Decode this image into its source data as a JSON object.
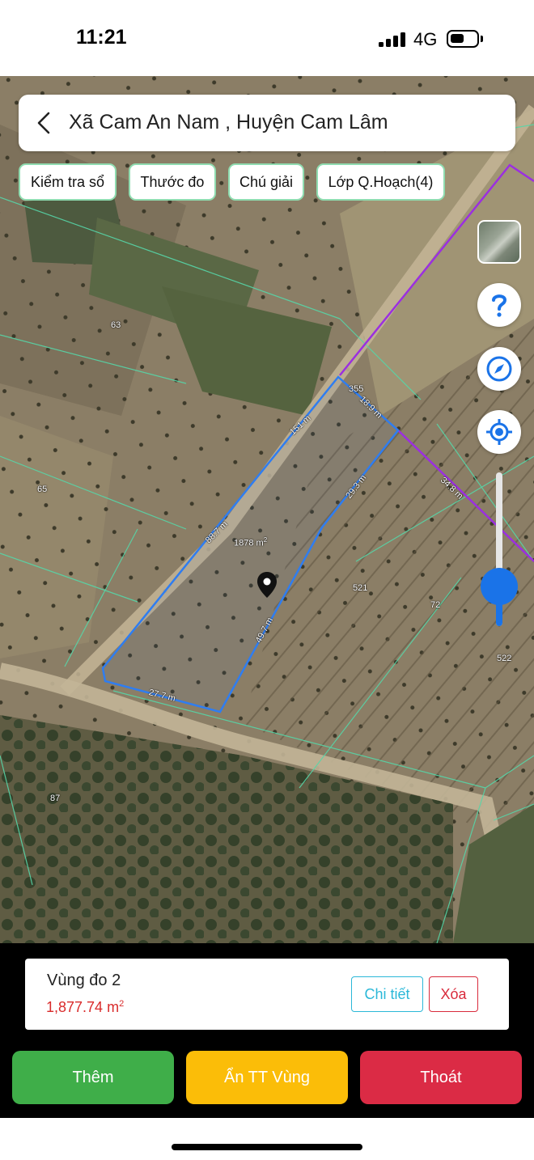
{
  "status_bar": {
    "time": "11:21",
    "network": "4G"
  },
  "header": {
    "title": "Xã Cam An Nam , Huyện Cam Lâm"
  },
  "chips": [
    {
      "label": "Kiểm tra sổ"
    },
    {
      "label": "Thước đo"
    },
    {
      "label": "Chú giải"
    },
    {
      "label": "Lớp Q.Hoạch(4)"
    }
  ],
  "map": {
    "parcel_numbers": [
      "63",
      "65",
      "355",
      "521",
      "72",
      "522",
      "87",
      "5"
    ],
    "area_label": {
      "value": "1878 m",
      "unit_sup": "2"
    },
    "edges": [
      "151 m",
      "18.9 m",
      "34.8 m",
      "29.3 m",
      "88.7 m",
      "49.7 m",
      "27.7 m"
    ],
    "zoom_level": 0.26,
    "colors": {
      "measure_line": "#2f7df0",
      "planning_line": "#9b2fe0",
      "parcel_line": "#56d6a8"
    }
  },
  "panel": {
    "area_name": "Vùng đo 2",
    "area_value": "1,877.74 m",
    "area_unit_sup": "2",
    "detail_label": "Chi tiết",
    "delete_label": "Xóa",
    "add_label": "Thêm",
    "hide_label": "Ẩn TT Vùng",
    "exit_label": "Thoát"
  }
}
